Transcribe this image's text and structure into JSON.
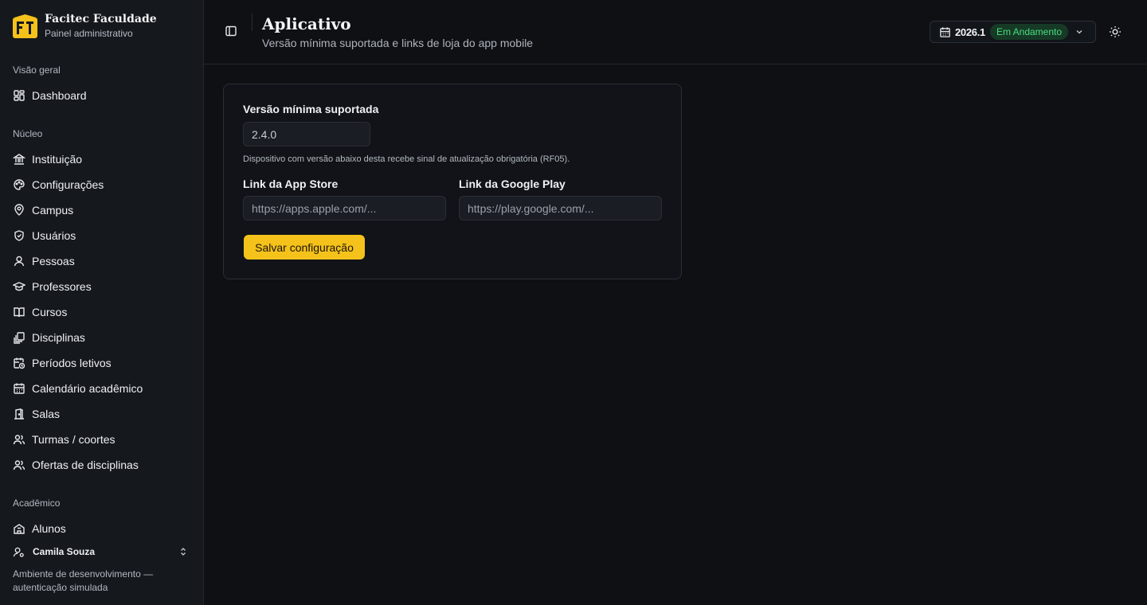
{
  "brand": {
    "name": "Facitec Faculdade",
    "subtitle": "Painel administrativo"
  },
  "sidebar": {
    "sections": [
      {
        "label": "Visão geral"
      },
      {
        "label": "Núcleo"
      },
      {
        "label": "Acadêmico"
      }
    ],
    "items": [
      {
        "label": "Dashboard",
        "icon": "dashboard-icon"
      },
      {
        "label": "Instituição",
        "icon": "landmark-icon"
      },
      {
        "label": "Configurações",
        "icon": "palette-icon"
      },
      {
        "label": "Campus",
        "icon": "map-pin-icon"
      },
      {
        "label": "Usuários",
        "icon": "shield-icon"
      },
      {
        "label": "Pessoas",
        "icon": "user-icon"
      },
      {
        "label": "Professores",
        "icon": "graduation-cap-icon"
      },
      {
        "label": "Cursos",
        "icon": "book-open-icon"
      },
      {
        "label": "Disciplinas",
        "icon": "library-icon"
      },
      {
        "label": "Períodos letivos",
        "icon": "calendar-clock-icon"
      },
      {
        "label": "Calendário acadêmico",
        "icon": "calendar-icon"
      },
      {
        "label": "Salas",
        "icon": "door-icon"
      },
      {
        "label": "Turmas / coortes",
        "icon": "users-icon"
      },
      {
        "label": "Ofertas de disciplinas",
        "icon": "users-icon"
      },
      {
        "label": "Alunos",
        "icon": "school-icon"
      }
    ],
    "user": {
      "name": "Camila Souza"
    },
    "env_note": "Ambiente de desenvolvimento — autenticação simulada"
  },
  "header": {
    "title": "Aplicativo",
    "subtitle": "Versão mínima suportada e links de loja do app mobile",
    "period": {
      "year": "2026.1",
      "status": "Em Andamento"
    }
  },
  "form": {
    "min_version": {
      "label": "Versão mínima suportada",
      "value": "2.4.0",
      "hint": "Dispositivo com versão abaixo desta recebe sinal de atualização obrigatória (RF05)."
    },
    "app_store": {
      "label": "Link da App Store",
      "placeholder": "https://apps.apple.com/..."
    },
    "google_play": {
      "label": "Link da Google Play",
      "placeholder": "https://play.google.com/..."
    },
    "save_label": "Salvar configuração"
  },
  "colors": {
    "accent": "#f5c21b",
    "status_green": "#4ade80",
    "background": "#0e1014",
    "sidebar": "#15181d"
  }
}
